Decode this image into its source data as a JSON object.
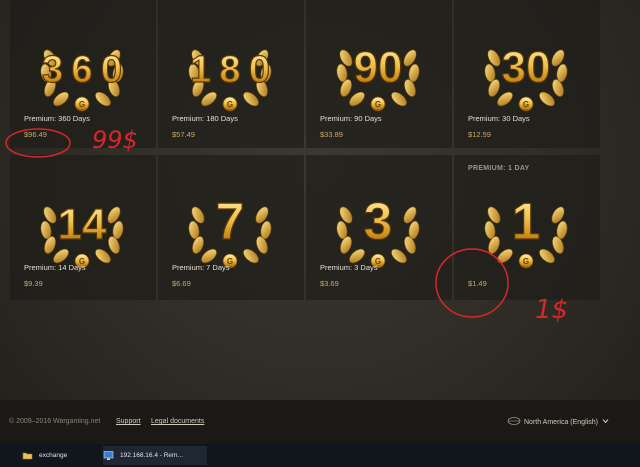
{
  "shop": {
    "cards": [
      {
        "number": "360",
        "title": "Premium: 360 Days",
        "price": "$96.49"
      },
      {
        "number": "180",
        "title": "Premium: 180 Days",
        "price": "$57.49"
      },
      {
        "number": "90",
        "title": "Premium: 90 Days",
        "price": "$33.89"
      },
      {
        "number": "30",
        "title": "Premium: 30 Days",
        "price": "$12.59"
      },
      {
        "number": "14",
        "title": "Premium: 14 Days",
        "price": "$9.39"
      },
      {
        "number": "7",
        "title": "Premium: 7 Days",
        "price": "$6.69"
      },
      {
        "number": "3",
        "title": "Premium: 3 Days",
        "price": "$3.69"
      },
      {
        "number": "1",
        "header": "PREMIUM: 1 DAY",
        "price": "$1.49"
      }
    ]
  },
  "annotations": {
    "note1": "99$",
    "note2": "1$",
    "color": "#d8262b"
  },
  "footer": {
    "copyright": "© 2009–2016 Wargaming.net",
    "support": "Support",
    "legal": "Legal documents",
    "region": "North America (English)",
    "region_icon": "globe-icon",
    "dropdown_icon": "chevron-down-icon"
  },
  "taskbar": {
    "items": [
      {
        "label": "exchange",
        "icon": "folder-icon"
      },
      {
        "label": "192.168.16.4 - Rem...",
        "icon": "remote-desktop-icon"
      }
    ]
  },
  "colors": {
    "gold": "#e0a83a",
    "price": "#c9a86a",
    "card_bg": "#1e1d19"
  }
}
